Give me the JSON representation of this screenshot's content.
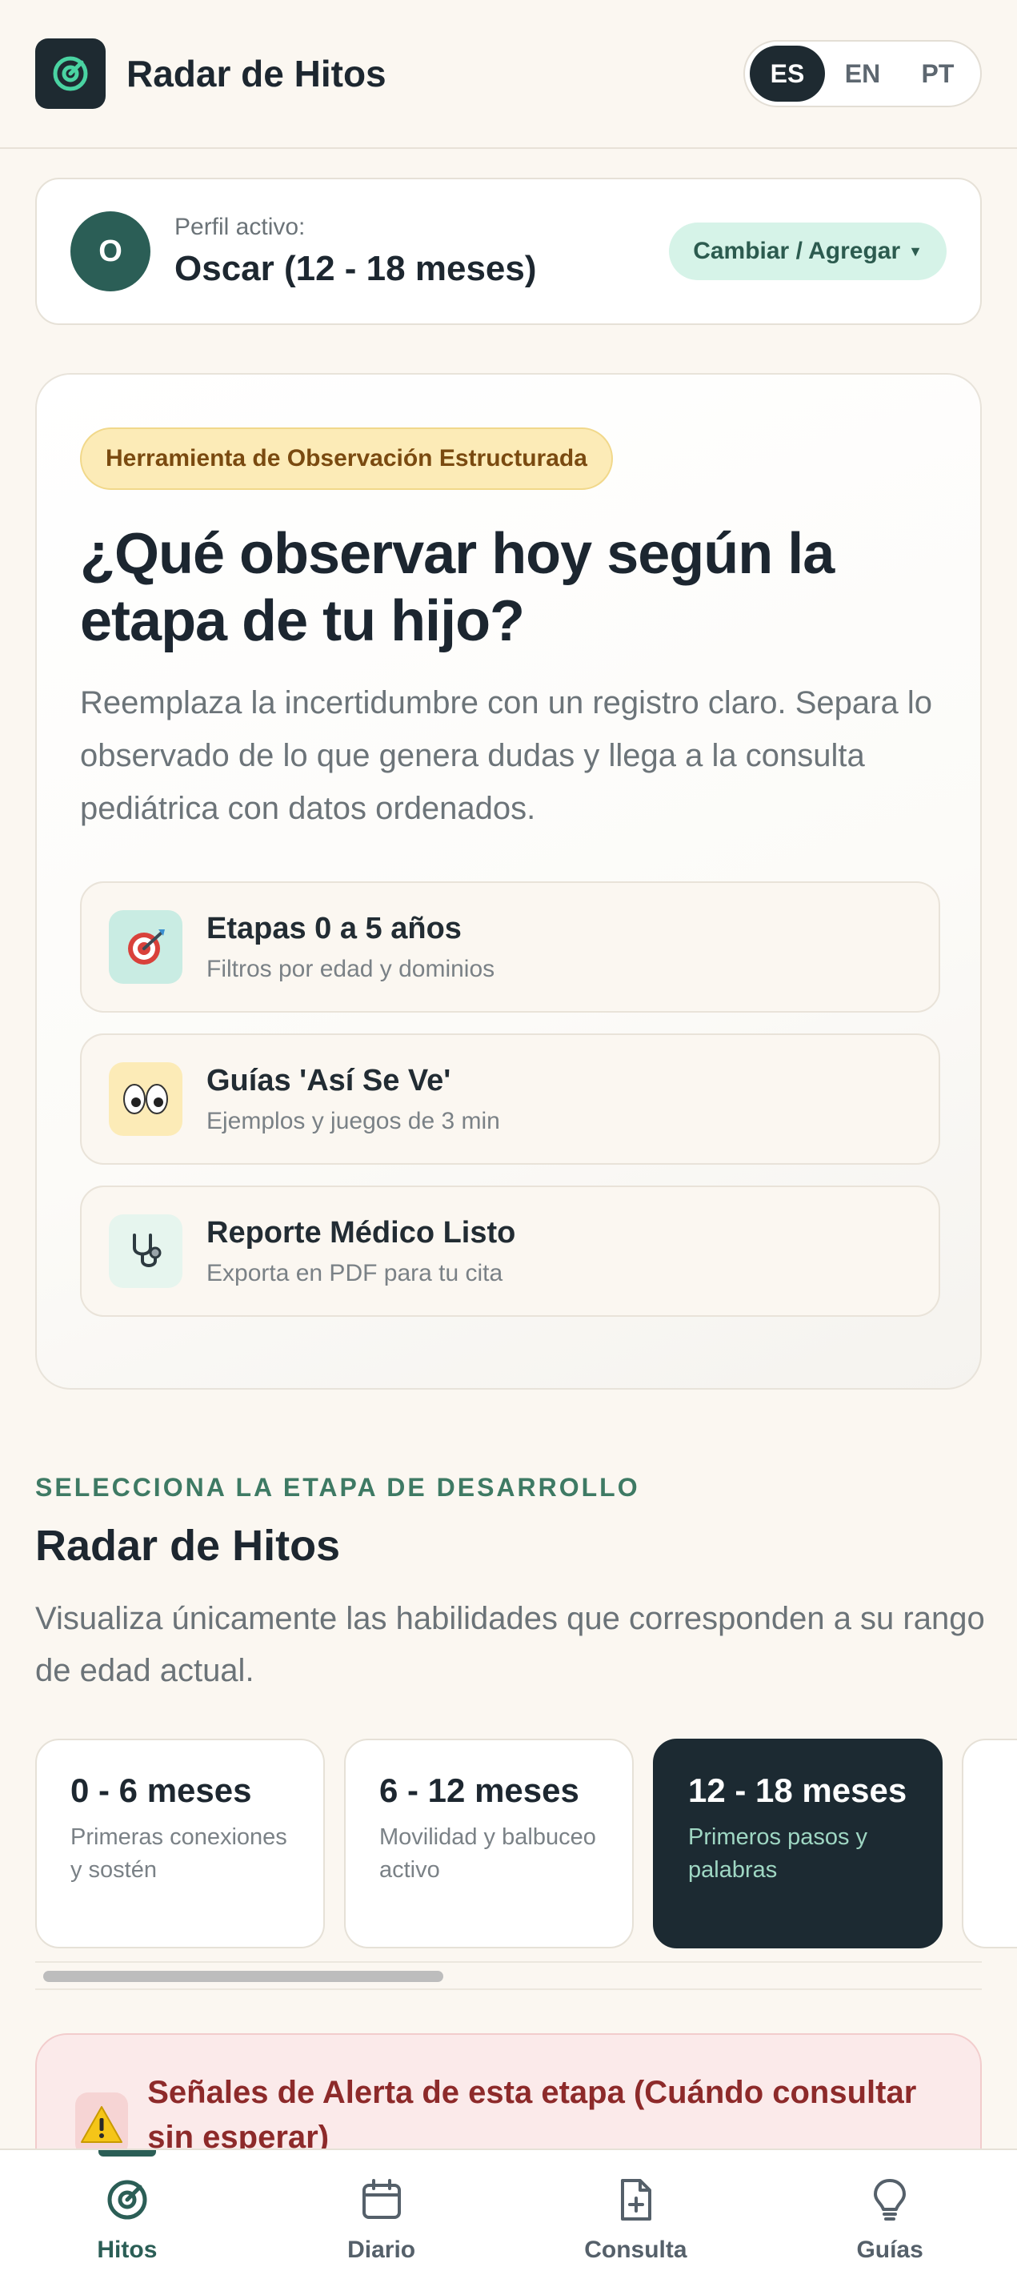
{
  "app": {
    "title": "Radar de Hitos"
  },
  "languages": [
    {
      "code": "ES",
      "active": true
    },
    {
      "code": "EN",
      "active": false
    },
    {
      "code": "PT",
      "active": false
    }
  ],
  "profile": {
    "initial": "O",
    "label": "Perfil activo:",
    "name": "Oscar (12 - 18 meses)",
    "switch_label": "Cambiar / Agregar"
  },
  "hero": {
    "badge": "Herramienta de Observación Estructurada",
    "title": "¿Qué observar hoy según la etapa de tu hijo?",
    "description": "Reemplaza la incertidumbre con un registro claro. Separa lo observado de lo que genera dudas y llega a la consulta pediátrica con datos ordenados.",
    "features": [
      {
        "icon": "target-dart-icon",
        "title": "Etapas 0 a 5 años",
        "subtitle": "Filtros por edad y dominios"
      },
      {
        "icon": "eyes-icon",
        "title": "Guías 'Así Se Ve'",
        "subtitle": "Ejemplos y juegos de 3 min"
      },
      {
        "icon": "stethoscope-icon",
        "title": "Reporte Médico Listo",
        "subtitle": "Exporta en PDF para tu cita"
      }
    ]
  },
  "stages_section": {
    "kicker": "SELECCIONA LA ETAPA DE DESARROLLO",
    "title": "Radar de Hitos",
    "description": "Visualiza únicamente las habilidades que corresponden a su rango de edad actual.",
    "stages": [
      {
        "title": "0 - 6 meses",
        "subtitle": "Primeras conexiones y sostén",
        "active": false
      },
      {
        "title": "6 - 12 meses",
        "subtitle": "Movilidad y balbuceo activo",
        "active": false
      },
      {
        "title": "12 - 18 meses",
        "subtitle": "Primeros pasos y palabras",
        "active": true
      }
    ]
  },
  "alert": {
    "text": "Señales de Alerta de esta etapa (Cuándo consultar sin esperar)"
  },
  "nav": [
    {
      "label": "Hitos",
      "icon": "radar-icon",
      "active": true
    },
    {
      "label": "Diario",
      "icon": "calendar-icon",
      "active": false
    },
    {
      "label": "Consulta",
      "icon": "document-plus-icon",
      "active": false
    },
    {
      "label": "Guías",
      "icon": "lightbulb-icon",
      "active": false
    }
  ],
  "colors": {
    "background": "#fbf7f1",
    "primary_dark": "#1c2a32",
    "accent_green": "#2b5e56",
    "badge_yellow": "#fcebb7",
    "alert_red": "#8d2a2a"
  }
}
